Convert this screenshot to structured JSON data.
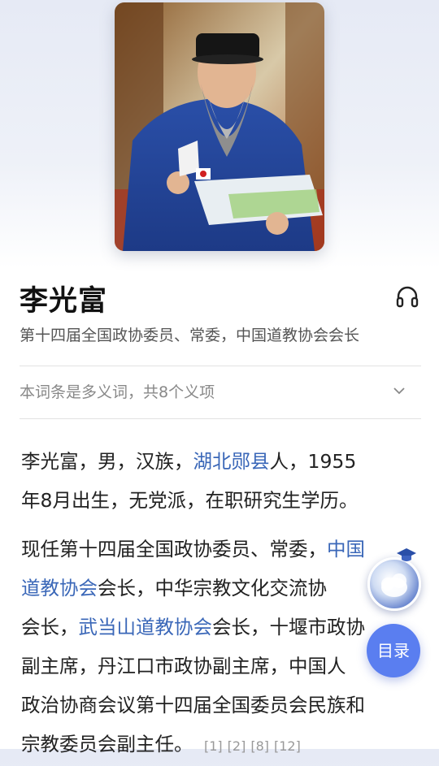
{
  "entry": {
    "name": "李光富",
    "subtitle": "第十四届全国政协委员、常委，中国道教协会会长",
    "polysemy_note": "本词条是多义词，共8个义项"
  },
  "paragraph1": {
    "before_link": "李光富，男，汉族，",
    "link": "湖北郧县",
    "line1_after": "人，1955",
    "line2": "年8月出生，无党派，在职研究生学历。"
  },
  "paragraph2": {
    "line1_text": "现任第十四届全国政协委员、常委，",
    "line1_link": "中国",
    "line2_link": "道教协会",
    "line2_text": "会长，中华宗教文化交流协",
    "line3_text1": "会长，",
    "line3_link": "武当山道教协会",
    "line3_text2": "会长，十堰市政协",
    "line4": "副主席，丹江口市政协副主席，中国人",
    "line5": "政治协商会议第十四届全国委员会民族和",
    "line6": "宗教委员会副主任。",
    "refs": [
      "[1]",
      "[2]",
      "[8]",
      "[12]"
    ]
  },
  "floating": {
    "toc_label": "目录"
  },
  "icons": {
    "audio": "headphones-icon",
    "expand": "chevron-down-icon",
    "assistant": "ai-assistant-icon"
  },
  "colors": {
    "link": "#3a67b8",
    "toc_button": "#5a7ef0"
  }
}
